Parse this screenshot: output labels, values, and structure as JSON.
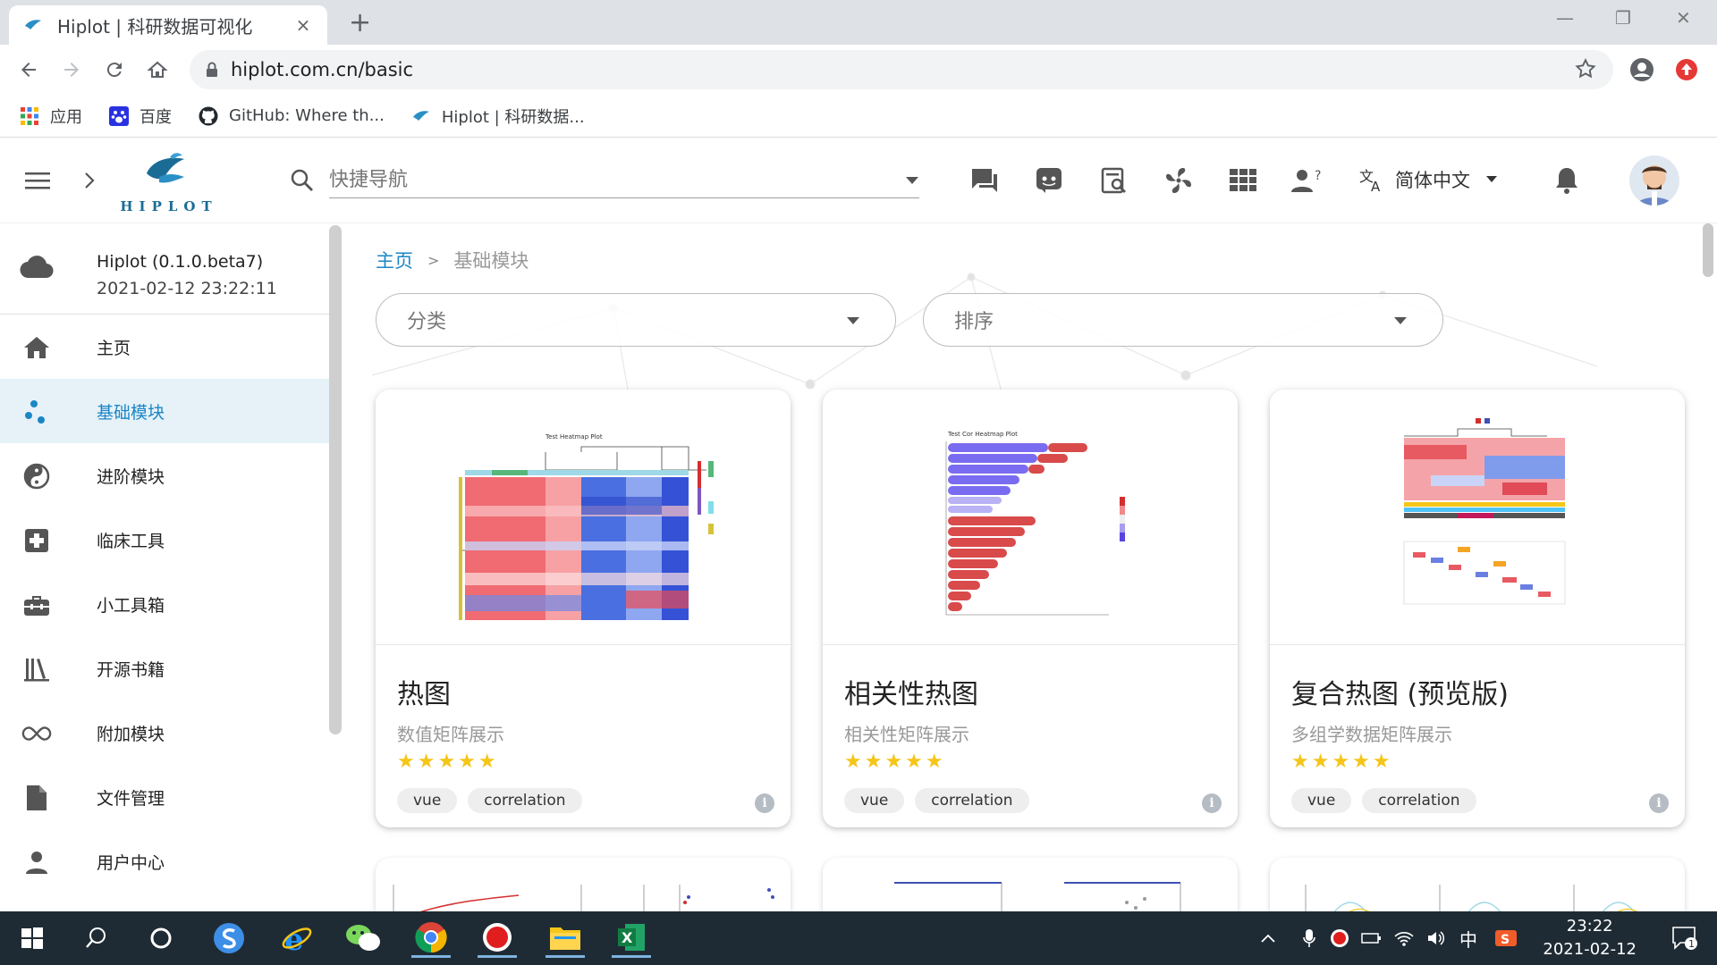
{
  "browser": {
    "tab_title": "Hiplot | 科研数据可视化",
    "tab_close": "×",
    "new_tab": "+",
    "url": "hiplot.com.cn/basic",
    "bookmarks": [
      {
        "label": "应用",
        "icon": "apps-grid-icon"
      },
      {
        "label": "百度",
        "icon": "baidu-paw-icon"
      },
      {
        "label": "GitHub: Where th...",
        "icon": "github-icon"
      },
      {
        "label": "Hiplot | 科研数据...",
        "icon": "hiplot-bird-icon"
      }
    ]
  },
  "header": {
    "logo_text": "HIPLOT",
    "quick_nav_placeholder": "快捷导航",
    "language": "简体中文",
    "icons": [
      "chat-icon",
      "discord-icon",
      "search-doc-icon",
      "fan-icon",
      "grid-icon",
      "help-user-icon",
      "translate-icon",
      "bell-icon",
      "avatar"
    ]
  },
  "sidebar": {
    "version_name": "Hiplot (0.1.0.beta7)",
    "version_date": "2021-02-12 23:22:11",
    "items": [
      {
        "label": "主页",
        "icon": "home-icon",
        "active": false
      },
      {
        "label": "基础模块",
        "icon": "scatter-dots-icon",
        "active": true
      },
      {
        "label": "进阶模块",
        "icon": "yin-yang-icon",
        "active": false
      },
      {
        "label": "临床工具",
        "icon": "medical-cross-icon",
        "active": false
      },
      {
        "label": "小工具箱",
        "icon": "toolbox-icon",
        "active": false
      },
      {
        "label": "开源书籍",
        "icon": "books-icon",
        "active": false
      },
      {
        "label": "附加模块",
        "icon": "infinity-icon",
        "active": false
      },
      {
        "label": "文件管理",
        "icon": "file-icon",
        "active": false
      },
      {
        "label": "用户中心",
        "icon": "user-icon",
        "active": false
      }
    ]
  },
  "main": {
    "breadcrumb_home": "主页",
    "breadcrumb_sep": ">",
    "breadcrumb_current": "基础模块",
    "category_placeholder": "分类",
    "sort_placeholder": "排序",
    "cards": [
      {
        "title": "热图",
        "subtitle": "数值矩阵展示",
        "stars": "★★★★★",
        "tags": [
          "vue",
          "correlation"
        ],
        "thumb_title": "Test Heatmap Plot"
      },
      {
        "title": "相关性热图",
        "subtitle": "相关性矩阵展示",
        "stars": "★★★★★",
        "tags": [
          "vue",
          "correlation"
        ],
        "thumb_title": "Test Cor Heatmap Plot"
      },
      {
        "title": "复合热图 (预览版)",
        "subtitle": "多组学数据矩阵展示",
        "stars": "★★★★★",
        "tags": [
          "vue",
          "correlation"
        ],
        "thumb_title": ""
      }
    ]
  },
  "taskbar": {
    "ime": "中",
    "time": "23:22",
    "date": "2021-02-12",
    "notification_count": "1"
  },
  "colors": {
    "accent": "#1b86c5",
    "active_bg": "#e6f1f8",
    "star": "#f5c518",
    "taskbar": "#1f2b34"
  }
}
